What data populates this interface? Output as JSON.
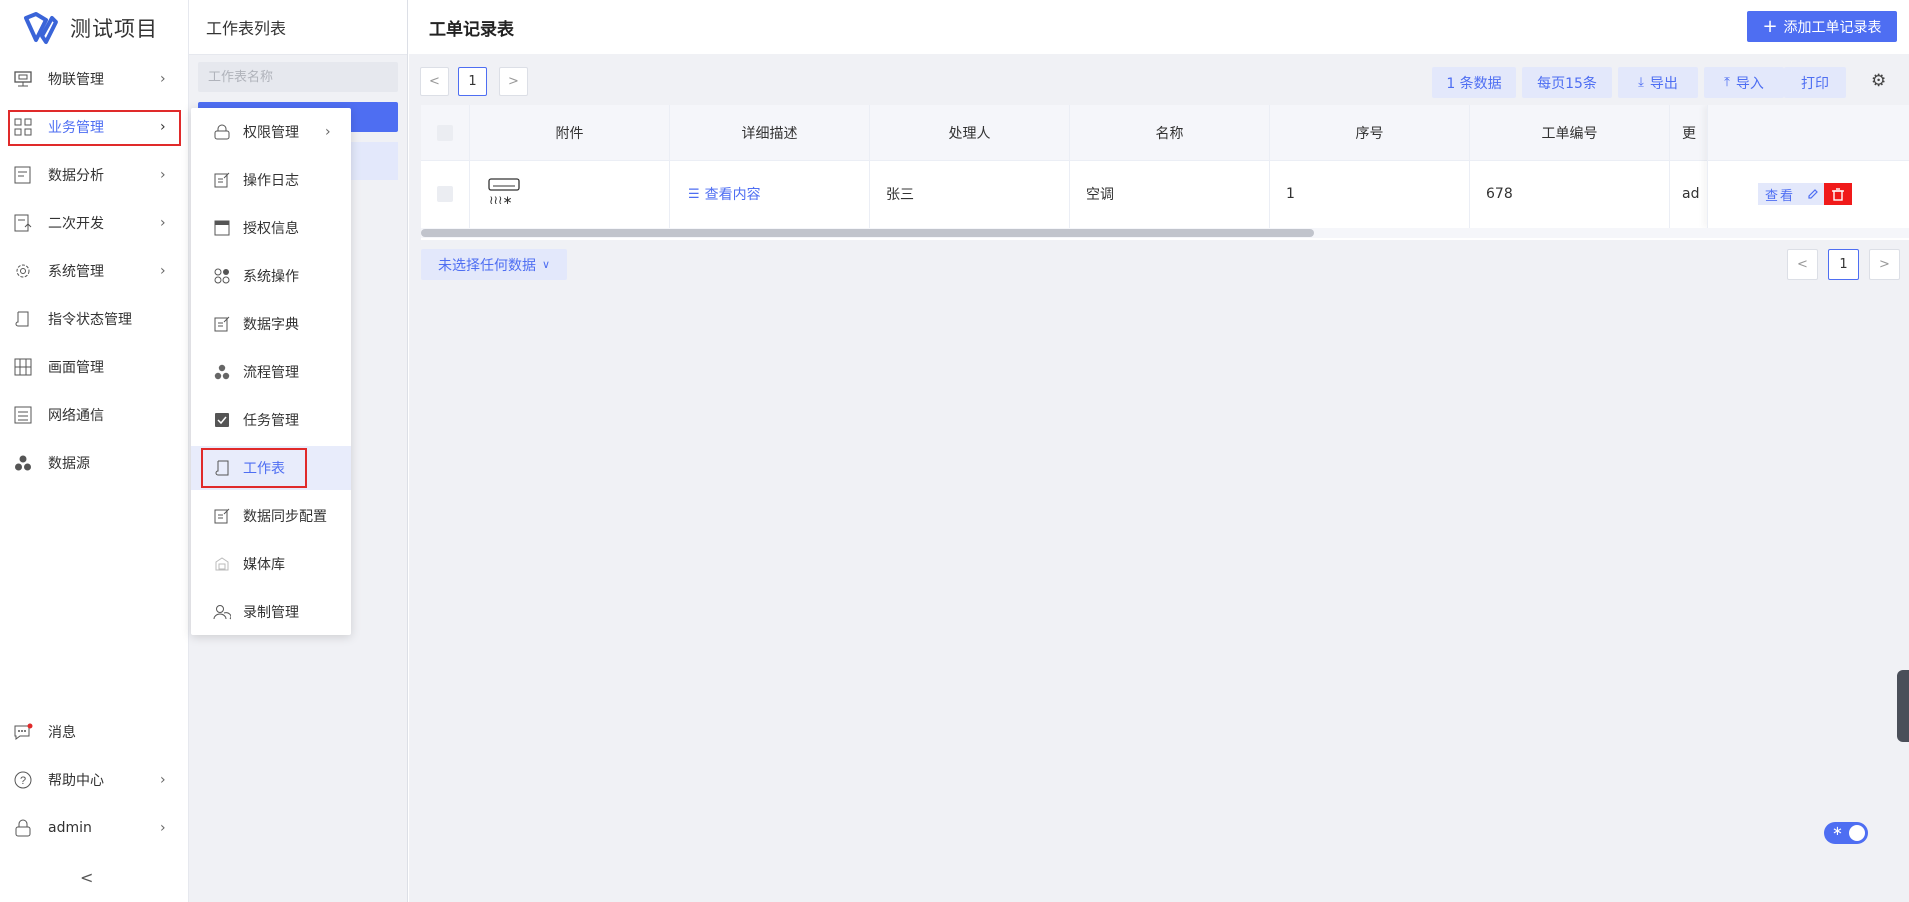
{
  "app": {
    "title": "测试项目"
  },
  "sidebar": {
    "items": [
      {
        "label": "物联管理",
        "icon": "monitor-icon",
        "has_arrow": true
      },
      {
        "label": "业务管理",
        "icon": "grid-icon",
        "has_arrow": true,
        "active": true
      },
      {
        "label": "数据分析",
        "icon": "chart-doc-icon",
        "has_arrow": true
      },
      {
        "label": "二次开发",
        "icon": "code-doc-icon",
        "has_arrow": true
      },
      {
        "label": "系统管理",
        "icon": "gear-icon",
        "has_arrow": true
      },
      {
        "label": "指令状态管理",
        "icon": "scroll-icon",
        "has_arrow": false
      },
      {
        "label": "画面管理",
        "icon": "screen-grid-icon",
        "has_arrow": false
      },
      {
        "label": "网络通信",
        "icon": "list-icon",
        "has_arrow": false
      },
      {
        "label": "数据源",
        "icon": "dots-cluster-icon",
        "has_arrow": false
      }
    ],
    "bottom": [
      {
        "label": "消息",
        "icon": "chat-icon",
        "has_arrow": false
      },
      {
        "label": "帮助中心",
        "icon": "help-icon",
        "has_arrow": true
      },
      {
        "label": "admin",
        "icon": "lock-icon",
        "has_arrow": true
      }
    ],
    "collapse": "<"
  },
  "list_panel": {
    "title": "工作表列表",
    "search_placeholder": "工作表名称"
  },
  "submenu": {
    "items": [
      {
        "label": "权限管理",
        "icon": "lock-icon",
        "has_arrow": true
      },
      {
        "label": "操作日志",
        "icon": "edit-doc-icon"
      },
      {
        "label": "授权信息",
        "icon": "window-icon"
      },
      {
        "label": "系统操作",
        "icon": "circles-icon"
      },
      {
        "label": "数据字典",
        "icon": "edit-doc-icon"
      },
      {
        "label": "流程管理",
        "icon": "dots-cluster-icon"
      },
      {
        "label": "任务管理",
        "icon": "check-doc-icon"
      },
      {
        "label": "工作表",
        "icon": "scroll-icon",
        "active": true
      },
      {
        "label": "数据同步配置",
        "icon": "edit-doc-icon"
      },
      {
        "label": "媒体库",
        "icon": "image-icon"
      },
      {
        "label": "录制管理",
        "icon": "users-icon"
      }
    ]
  },
  "main": {
    "title": "工单记录表",
    "add_button": "添加工单记录表",
    "pagination": {
      "prev": "<",
      "page": "1",
      "next": ">"
    },
    "toolbar": {
      "count": "1 条数据",
      "per_page": "每页15条",
      "export": "导出",
      "import": "导入",
      "print": "打印"
    },
    "table": {
      "headers": [
        "附件",
        "详细描述",
        "处理人",
        "名称",
        "序号",
        "工单编号",
        "更"
      ],
      "rows": [
        {
          "attachment_icon": "air-conditioner-icon",
          "description_link": "查看内容",
          "handler": "张三",
          "name": "空调",
          "index": "1",
          "order_no": "678",
          "more": "ad"
        }
      ],
      "actions": {
        "view": "查看"
      }
    },
    "selection": "未选择任何数据"
  },
  "colors": {
    "accent": "#4e6ef2",
    "danger": "#f01a1a",
    "highlight": "#e02a2a"
  }
}
